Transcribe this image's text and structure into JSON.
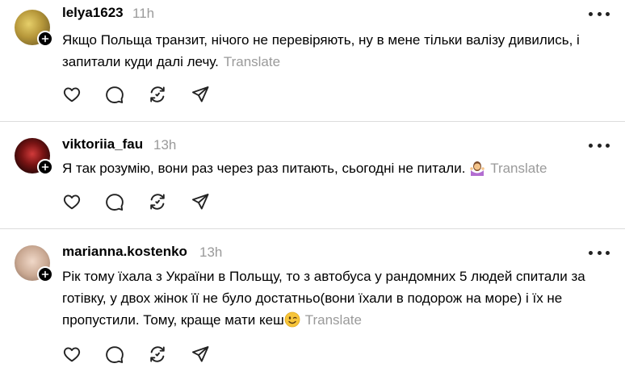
{
  "comments": [
    {
      "username": "lelya1623",
      "time": "11h",
      "text": "Якщо Польща транзит, нічого не перевіряють, ну в мене тільки валізу дивились, і запитали куди далі лечу.",
      "translate": "Translate"
    },
    {
      "username": "viktoriia_fau",
      "time": "13h",
      "text": "Я так розумію, вони раз через раз питають, сьогодні не питали.",
      "emoji": "person-shrugging-emoji",
      "translate": "Translate"
    },
    {
      "username": "marianna.kostenko",
      "time": "13h",
      "text": "Рік тому їхала з України в Польщу, то з автобуса у рандомних 5 людей спитали за готівку, у двох жінок її не було достатньо(вони їхали в подорож на море) і їх не пропустили. Тому, краще мати кеш",
      "emoji": "winking-face-emoji",
      "translate": "Translate"
    }
  ],
  "icons": {
    "like": "heart-icon",
    "reply": "comment-icon",
    "repost": "repost-icon",
    "share": "send-icon",
    "more": "more-icon",
    "follow": "plus-icon"
  },
  "colors": {
    "text": "#000000",
    "muted": "#9a9a9a",
    "divider": "#dcdcdc"
  }
}
